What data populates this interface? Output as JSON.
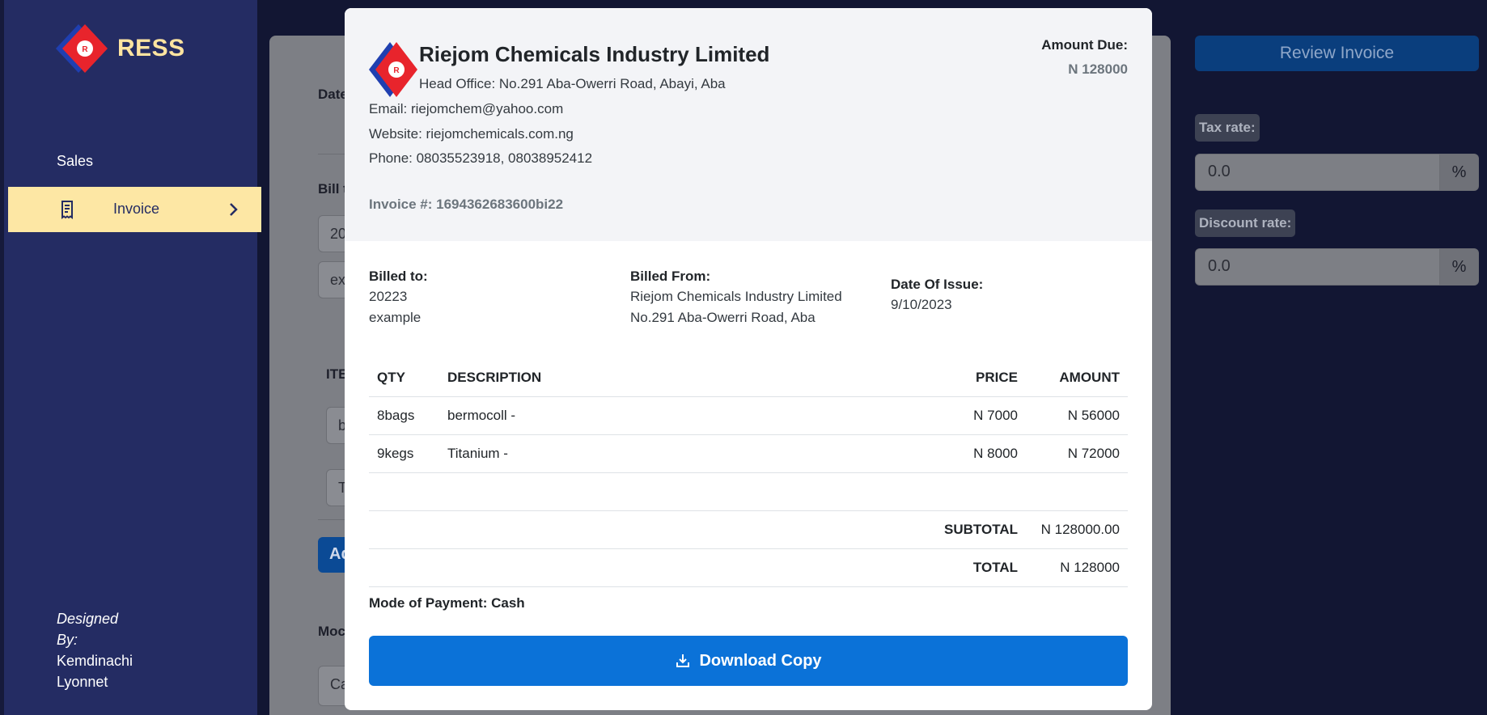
{
  "sidebar": {
    "brand": "RESS",
    "section": "Sales",
    "active_item": "Invoice",
    "credit_line1": "Designed",
    "credit_line2": "By:",
    "credit_line3": "Kemdinachi",
    "credit_line4": "Lyonnet"
  },
  "main": {
    "frag_date": "Date",
    "frag_bill": "Bill t",
    "frag_field1": "20",
    "frag_field2": "ex",
    "frag_items": "ITE",
    "frag_item1": "b",
    "frag_item2": "T",
    "frag_add": "Ad",
    "frag_mode": "Moc",
    "frag_mode_value": "Ca"
  },
  "settings": {
    "review_button": "Review Invoice",
    "tax_label": "Tax rate:",
    "tax_value": "0.0",
    "discount_label": "Discount rate:",
    "discount_value": "0.0",
    "percent": "%"
  },
  "invoice": {
    "company": "Riejom Chemicals Industry Limited",
    "head_office": "Head Office: No.291 Aba-Owerri Road, Abayi, Aba",
    "email": "Email: riejomchem@yahoo.com",
    "website": "Website: riejomchemicals.com.ng",
    "phone": "Phone: 08035523918, 08038952412",
    "amount_due_label": "Amount Due:",
    "amount_due_value": "N 128000",
    "invoice_number": "Invoice #: 1694362683600bi22",
    "billed_to_label": "Billed to:",
    "billed_to_line1": "20223",
    "billed_to_line2": "example",
    "billed_from_label": "Billed From:",
    "billed_from_line1": "Riejom Chemicals Industry Limited",
    "billed_from_line2": "No.291 Aba-Owerri Road, Aba",
    "date_label": "Date Of Issue:",
    "date_value": "9/10/2023",
    "columns": {
      "qty": "QTY",
      "description": "DESCRIPTION",
      "price": "PRICE",
      "amount": "AMOUNT"
    },
    "items": [
      {
        "qty": "8bags",
        "description": "bermocoll -",
        "price": "N 7000",
        "amount": "N 56000"
      },
      {
        "qty": "9kegs",
        "description": "Titanium -",
        "price": "N 8000",
        "amount": "N 72000"
      }
    ],
    "subtotal_label": "SUBTOTAL",
    "subtotal_value": "N 128000.00",
    "total_label": "TOTAL",
    "total_value": "N 128000",
    "mode_of_payment": "Mode of Payment: Cash",
    "download_button": "Download Copy"
  },
  "colors": {
    "sidebar": "#242c63",
    "accent_yellow": "#fde7a4",
    "primary_blue": "#0b72d8",
    "logo_red": "#e8242c",
    "logo_blue": "#1f3fb0"
  }
}
